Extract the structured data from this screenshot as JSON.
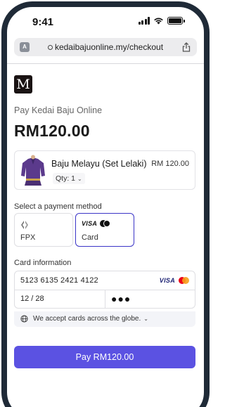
{
  "status_bar": {
    "time": "9:41"
  },
  "browser": {
    "url": "kedaibajuonline.my/checkout"
  },
  "merchant": {
    "logo_letter": "M",
    "pay_to": "Pay Kedai Baju Online"
  },
  "order": {
    "total": "RM120.00",
    "item_name": "Baju Melayu (Set Lelaki)",
    "item_price": "RM 120.00",
    "quantity_label": "Qty: 1"
  },
  "payment": {
    "section_title": "Select a payment method",
    "methods": [
      {
        "label": "FPX",
        "selected": false
      },
      {
        "label": "Card",
        "selected": true
      }
    ]
  },
  "card": {
    "section_title": "Card information",
    "number": "5123 6135 2421 4122",
    "expiry": "12 / 28",
    "cvc": "●●●",
    "brands": [
      "VISA",
      "Mastercard"
    ],
    "visa_text": "VISA",
    "note": "We accept cards across the globe."
  },
  "actions": {
    "pay_label": "Pay RM120.00"
  },
  "colors": {
    "accent": "#5b52e2",
    "selected_border": "#3b35c7",
    "frame": "#1f2a37",
    "visa_blue": "#1a1f71",
    "mc_red": "#eb001b",
    "mc_orange": "#f79e1b"
  },
  "icons": [
    "translate-icon",
    "lock-icon",
    "share-icon",
    "fpx-icon",
    "visa-icon",
    "mastercard-icon",
    "globe-icon",
    "chevron-down-icon"
  ]
}
